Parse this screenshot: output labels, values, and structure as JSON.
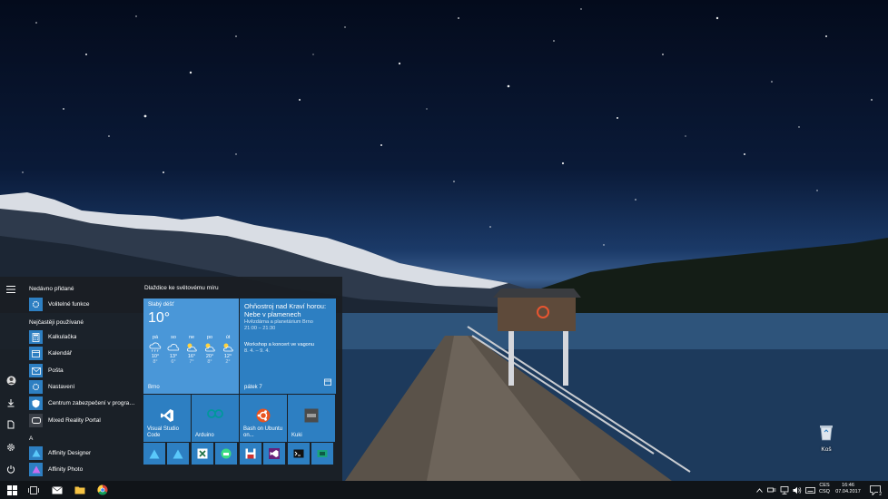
{
  "start_menu": {
    "recent_header": "Nedávno přidané",
    "recent_items": [
      {
        "label": "Volitelné funkce",
        "icon": "gear-icon"
      }
    ],
    "most_used_header": "Nejčastěji používané",
    "most_used_items": [
      {
        "label": "Kalkulačka",
        "icon": "calculator-icon"
      },
      {
        "label": "Kalendář",
        "icon": "calendar-icon"
      },
      {
        "label": "Pošta",
        "icon": "mail-icon"
      },
      {
        "label": "Nastavení",
        "icon": "gear-icon"
      },
      {
        "label": "Centrum zabezpečení v programu...",
        "icon": "shield-icon"
      },
      {
        "label": "Mixed Reality Portal",
        "icon": "mixed-reality-icon"
      }
    ],
    "alpha_header": "A",
    "alpha_items": [
      {
        "label": "Affinity Designer",
        "icon": "affinity-designer-icon"
      },
      {
        "label": "Affinity Photo",
        "icon": "affinity-photo-icon"
      }
    ],
    "tiles_header": "Dlaždice ke světovému míru",
    "weather": {
      "condition": "Slabý déšť",
      "temperature": "10°",
      "city": "Brno",
      "days": [
        {
          "day": "pá",
          "high": "10°",
          "low": "8°",
          "icon": "rain-cloud-icon"
        },
        {
          "day": "so",
          "high": "13°",
          "low": "6°",
          "icon": "cloud-icon"
        },
        {
          "day": "ne",
          "high": "16°",
          "low": "7°",
          "icon": "partly-sunny-icon"
        },
        {
          "day": "po",
          "high": "20°",
          "low": "8°",
          "icon": "partly-sunny-icon"
        },
        {
          "day": "út",
          "high": "12°",
          "low": "2°",
          "icon": "partly-sunny-icon"
        }
      ]
    },
    "calendar": {
      "title": "Ohňostroj nad Kraví horou: Nebe v plamenech",
      "subtitle": "Hvězdárna a planetárium Brno",
      "time": "21:00 – 21:30",
      "event2": "Workshop a koncert ve vagonu",
      "event2_dates": "8. 4. – 9. 4.",
      "date": "pátek 7"
    },
    "medium_tiles": [
      {
        "label": "Visual Studio Code",
        "icon": "vscode-icon"
      },
      {
        "label": "Arduino",
        "icon": "arduino-icon"
      },
      {
        "label": "Bash on Ubuntu on...",
        "icon": "ubuntu-icon"
      },
      {
        "label": "Kuki",
        "icon": "kuki-icon"
      }
    ],
    "small_tiles": [
      {
        "icon": "affinity-designer-icon",
        "bg": "#2d7fc2"
      },
      {
        "icon": "affinity-designer-icon",
        "bg": "#2d7fc2"
      },
      {
        "icon": "excel-icon",
        "bg": "#2d7fc2"
      },
      {
        "icon": "android-studio-icon",
        "bg": "#2d7fc2"
      },
      {
        "icon": "floppy-icon",
        "bg": "#2d7fc2"
      },
      {
        "icon": "visual-studio-icon",
        "bg": "#2d7fc2"
      },
      {
        "icon": "terminal-icon",
        "bg": "#2d7fc2"
      },
      {
        "icon": "teal-app-icon",
        "bg": "#2d7fc2"
      }
    ]
  },
  "desktop": {
    "recycle_bin_label": "Koš"
  },
  "taskbar": {
    "language_top": "CES",
    "language_bottom": "CSQ",
    "time": "16:46",
    "date": "07.04.2017",
    "notification_count": "2"
  },
  "colors": {
    "tile_accent": "#2d7fc2",
    "weather_tile": "#4a97d8",
    "start_bg": "#1a1e24",
    "taskbar_bg": "#101418"
  }
}
